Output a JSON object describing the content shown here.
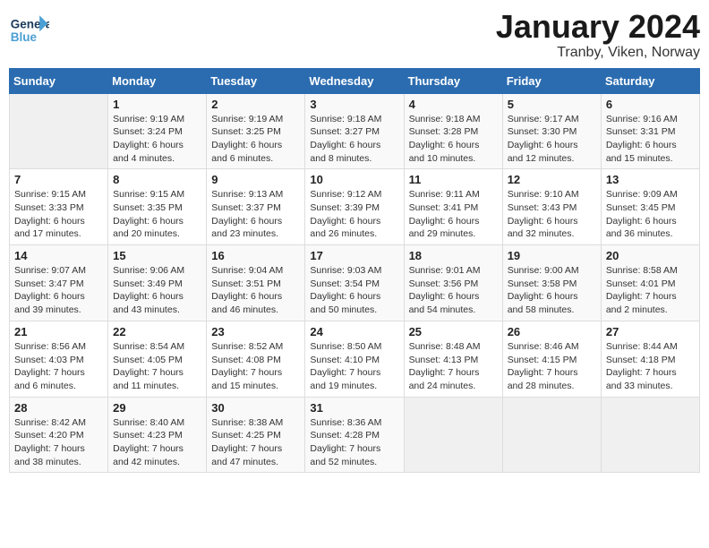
{
  "header": {
    "logo_general": "General",
    "logo_blue": "Blue",
    "title": "January 2024",
    "location": "Tranby, Viken, Norway"
  },
  "weekdays": [
    "Sunday",
    "Monday",
    "Tuesday",
    "Wednesday",
    "Thursday",
    "Friday",
    "Saturday"
  ],
  "weeks": [
    [
      {
        "day": "",
        "sunrise": "",
        "sunset": "",
        "daylight": ""
      },
      {
        "day": "1",
        "sunrise": "Sunrise: 9:19 AM",
        "sunset": "Sunset: 3:24 PM",
        "daylight": "Daylight: 6 hours and 4 minutes."
      },
      {
        "day": "2",
        "sunrise": "Sunrise: 9:19 AM",
        "sunset": "Sunset: 3:25 PM",
        "daylight": "Daylight: 6 hours and 6 minutes."
      },
      {
        "day": "3",
        "sunrise": "Sunrise: 9:18 AM",
        "sunset": "Sunset: 3:27 PM",
        "daylight": "Daylight: 6 hours and 8 minutes."
      },
      {
        "day": "4",
        "sunrise": "Sunrise: 9:18 AM",
        "sunset": "Sunset: 3:28 PM",
        "daylight": "Daylight: 6 hours and 10 minutes."
      },
      {
        "day": "5",
        "sunrise": "Sunrise: 9:17 AM",
        "sunset": "Sunset: 3:30 PM",
        "daylight": "Daylight: 6 hours and 12 minutes."
      },
      {
        "day": "6",
        "sunrise": "Sunrise: 9:16 AM",
        "sunset": "Sunset: 3:31 PM",
        "daylight": "Daylight: 6 hours and 15 minutes."
      }
    ],
    [
      {
        "day": "7",
        "sunrise": "Sunrise: 9:15 AM",
        "sunset": "Sunset: 3:33 PM",
        "daylight": "Daylight: 6 hours and 17 minutes."
      },
      {
        "day": "8",
        "sunrise": "Sunrise: 9:15 AM",
        "sunset": "Sunset: 3:35 PM",
        "daylight": "Daylight: 6 hours and 20 minutes."
      },
      {
        "day": "9",
        "sunrise": "Sunrise: 9:13 AM",
        "sunset": "Sunset: 3:37 PM",
        "daylight": "Daylight: 6 hours and 23 minutes."
      },
      {
        "day": "10",
        "sunrise": "Sunrise: 9:12 AM",
        "sunset": "Sunset: 3:39 PM",
        "daylight": "Daylight: 6 hours and 26 minutes."
      },
      {
        "day": "11",
        "sunrise": "Sunrise: 9:11 AM",
        "sunset": "Sunset: 3:41 PM",
        "daylight": "Daylight: 6 hours and 29 minutes."
      },
      {
        "day": "12",
        "sunrise": "Sunrise: 9:10 AM",
        "sunset": "Sunset: 3:43 PM",
        "daylight": "Daylight: 6 hours and 32 minutes."
      },
      {
        "day": "13",
        "sunrise": "Sunrise: 9:09 AM",
        "sunset": "Sunset: 3:45 PM",
        "daylight": "Daylight: 6 hours and 36 minutes."
      }
    ],
    [
      {
        "day": "14",
        "sunrise": "Sunrise: 9:07 AM",
        "sunset": "Sunset: 3:47 PM",
        "daylight": "Daylight: 6 hours and 39 minutes."
      },
      {
        "day": "15",
        "sunrise": "Sunrise: 9:06 AM",
        "sunset": "Sunset: 3:49 PM",
        "daylight": "Daylight: 6 hours and 43 minutes."
      },
      {
        "day": "16",
        "sunrise": "Sunrise: 9:04 AM",
        "sunset": "Sunset: 3:51 PM",
        "daylight": "Daylight: 6 hours and 46 minutes."
      },
      {
        "day": "17",
        "sunrise": "Sunrise: 9:03 AM",
        "sunset": "Sunset: 3:54 PM",
        "daylight": "Daylight: 6 hours and 50 minutes."
      },
      {
        "day": "18",
        "sunrise": "Sunrise: 9:01 AM",
        "sunset": "Sunset: 3:56 PM",
        "daylight": "Daylight: 6 hours and 54 minutes."
      },
      {
        "day": "19",
        "sunrise": "Sunrise: 9:00 AM",
        "sunset": "Sunset: 3:58 PM",
        "daylight": "Daylight: 6 hours and 58 minutes."
      },
      {
        "day": "20",
        "sunrise": "Sunrise: 8:58 AM",
        "sunset": "Sunset: 4:01 PM",
        "daylight": "Daylight: 7 hours and 2 minutes."
      }
    ],
    [
      {
        "day": "21",
        "sunrise": "Sunrise: 8:56 AM",
        "sunset": "Sunset: 4:03 PM",
        "daylight": "Daylight: 7 hours and 6 minutes."
      },
      {
        "day": "22",
        "sunrise": "Sunrise: 8:54 AM",
        "sunset": "Sunset: 4:05 PM",
        "daylight": "Daylight: 7 hours and 11 minutes."
      },
      {
        "day": "23",
        "sunrise": "Sunrise: 8:52 AM",
        "sunset": "Sunset: 4:08 PM",
        "daylight": "Daylight: 7 hours and 15 minutes."
      },
      {
        "day": "24",
        "sunrise": "Sunrise: 8:50 AM",
        "sunset": "Sunset: 4:10 PM",
        "daylight": "Daylight: 7 hours and 19 minutes."
      },
      {
        "day": "25",
        "sunrise": "Sunrise: 8:48 AM",
        "sunset": "Sunset: 4:13 PM",
        "daylight": "Daylight: 7 hours and 24 minutes."
      },
      {
        "day": "26",
        "sunrise": "Sunrise: 8:46 AM",
        "sunset": "Sunset: 4:15 PM",
        "daylight": "Daylight: 7 hours and 28 minutes."
      },
      {
        "day": "27",
        "sunrise": "Sunrise: 8:44 AM",
        "sunset": "Sunset: 4:18 PM",
        "daylight": "Daylight: 7 hours and 33 minutes."
      }
    ],
    [
      {
        "day": "28",
        "sunrise": "Sunrise: 8:42 AM",
        "sunset": "Sunset: 4:20 PM",
        "daylight": "Daylight: 7 hours and 38 minutes."
      },
      {
        "day": "29",
        "sunrise": "Sunrise: 8:40 AM",
        "sunset": "Sunset: 4:23 PM",
        "daylight": "Daylight: 7 hours and 42 minutes."
      },
      {
        "day": "30",
        "sunrise": "Sunrise: 8:38 AM",
        "sunset": "Sunset: 4:25 PM",
        "daylight": "Daylight: 7 hours and 47 minutes."
      },
      {
        "day": "31",
        "sunrise": "Sunrise: 8:36 AM",
        "sunset": "Sunset: 4:28 PM",
        "daylight": "Daylight: 7 hours and 52 minutes."
      },
      {
        "day": "",
        "sunrise": "",
        "sunset": "",
        "daylight": ""
      },
      {
        "day": "",
        "sunrise": "",
        "sunset": "",
        "daylight": ""
      },
      {
        "day": "",
        "sunrise": "",
        "sunset": "",
        "daylight": ""
      }
    ]
  ]
}
